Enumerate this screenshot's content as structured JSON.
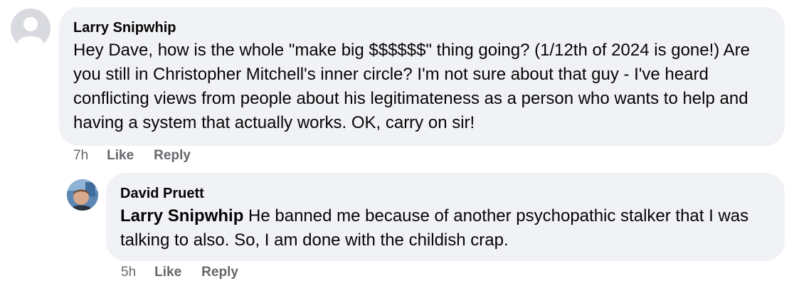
{
  "comments": [
    {
      "author": "Larry Snipwhip",
      "text": "Hey Dave, how is the whole \"make big $$$$$$\" thing going? (1/12th of 2024 is gone!) Are you still in Christopher Mitchell's inner circle? I'm not sure about that guy - I've heard conflicting views from people about his legitimateness as a person who wants to help and having a system that actually works. OK, carry on sir!",
      "time": "7h",
      "like_label": "Like",
      "reply_label": "Reply"
    },
    {
      "author": "David Pruett",
      "mention": "Larry Snipwhip",
      "text": " He banned me because of another psychopathic stalker that I was talking to also. So, I am done with the childish crap.",
      "time": "5h",
      "like_label": "Like",
      "reply_label": "Reply"
    }
  ]
}
